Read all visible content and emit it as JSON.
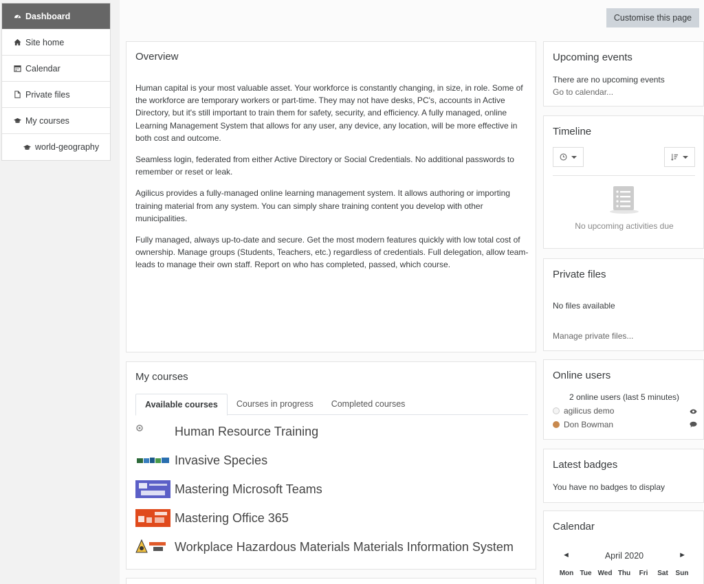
{
  "sidebar": {
    "items": [
      {
        "label": "Dashboard",
        "icon": "dashboard-icon",
        "active": true
      },
      {
        "label": "Site home",
        "icon": "home-icon"
      },
      {
        "label": "Calendar",
        "icon": "calendar-icon"
      },
      {
        "label": "Private files",
        "icon": "file-icon"
      },
      {
        "label": "My courses",
        "icon": "graduation-cap-icon"
      },
      {
        "label": "world-geography",
        "icon": "graduation-cap-icon",
        "sub": true
      }
    ]
  },
  "header": {
    "customise_label": "Customise this page"
  },
  "overview": {
    "title": "Overview",
    "paragraphs": [
      "Human capital is your most valuable asset. Your workforce is constantly changing, in size, in role. Some of the workforce are temporary workers or part-time. They may not have desks, PC's, accounts in Active Directory, but it's still important to train them for safety, security, and efficiency. A fully managed, online Learning Management System that allows for any user, any device, any location, will be more effective in both cost and outcome.",
      "Seamless login, federated from either Active Directory or Social Credentials. No additional passwords to remember or reset or leak.",
      "Agilicus provides a fully-managed online learning management system. It allows authoring or importing training material from any system. You can simply share training content you develop with other municipalities.",
      "Fully managed, always up-to-date and secure. Get the most modern features quickly with low total cost of ownership. Manage groups (Students, Teachers, etc.) regardless of credentials. Full delegation, allow team-leads to manage their own staff. Report on who has completed, passed, which course."
    ]
  },
  "my_courses": {
    "title": "My courses",
    "tabs": [
      "Available courses",
      "Courses in progress",
      "Completed courses"
    ],
    "courses": [
      "Human Resource Training",
      "Invasive Species",
      "Mastering Microsoft Teams",
      "Mastering Office 365",
      "Workplace Hazardous Materials Materials Information System"
    ]
  },
  "upcoming_events": {
    "title": "Upcoming events",
    "empty": "There are no upcoming events",
    "link": "Go to calendar..."
  },
  "timeline": {
    "title": "Timeline",
    "empty": "No upcoming activities due"
  },
  "private_files": {
    "title": "Private files",
    "empty": "No files available",
    "link": "Manage private files..."
  },
  "online_users": {
    "title": "Online users",
    "summary": "2 online users (last 5 minutes)",
    "users": [
      "agilicus demo",
      "Don Bowman"
    ]
  },
  "latest_badges": {
    "title": "Latest badges",
    "empty": "You have no badges to display"
  },
  "calendar": {
    "title": "Calendar",
    "month": "April 2020",
    "prev": "◄",
    "next": "►",
    "days": [
      "Mon",
      "Tue",
      "Wed",
      "Thu",
      "Fri",
      "Sat",
      "Sun"
    ]
  }
}
